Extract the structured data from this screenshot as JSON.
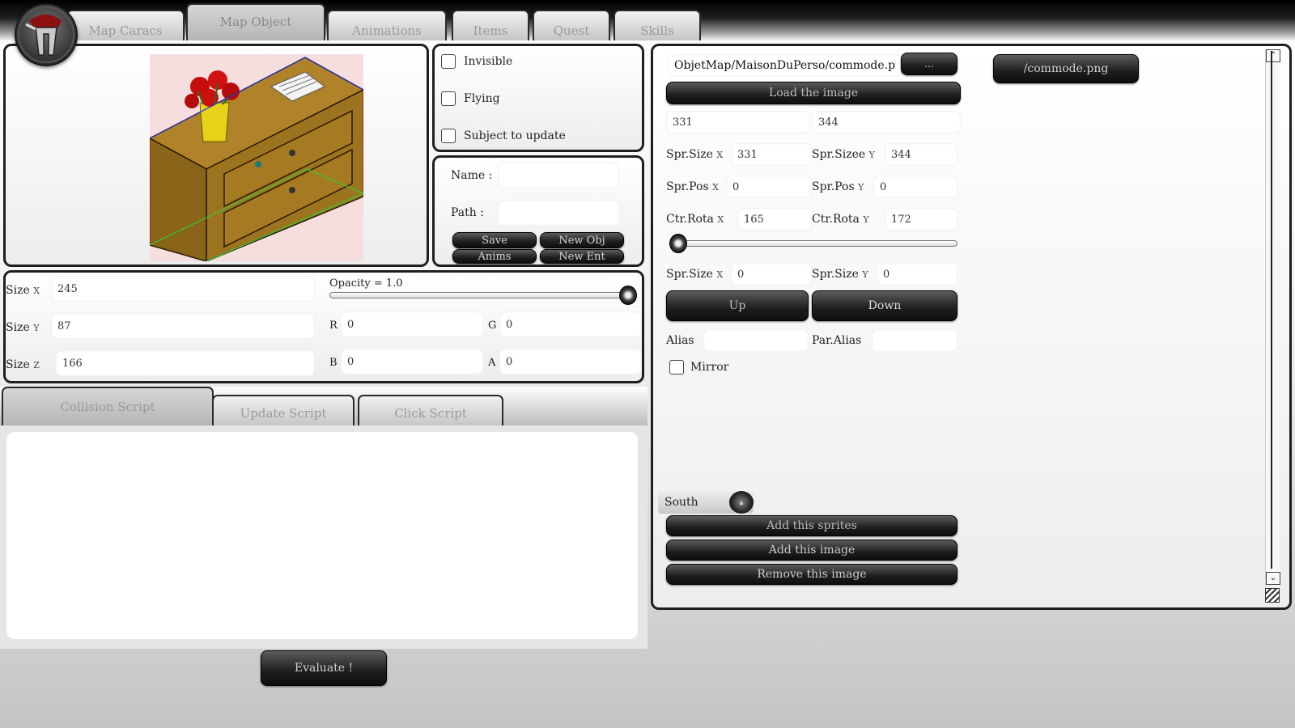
{
  "nav_tabs": [
    {
      "label": "Map Caracs"
    },
    {
      "label": "Map Object"
    },
    {
      "label": "Animations"
    },
    {
      "label": "Items"
    },
    {
      "label": "Quest"
    },
    {
      "label": "Skills"
    }
  ],
  "flags": {
    "invisible": "Invisible",
    "flying": "Flying",
    "subject_to_update": "Subject to update"
  },
  "object_form": {
    "name_label": "Name :",
    "name_value": "",
    "path_label": "Path :",
    "path_value": "",
    "save": "Save",
    "new_obj": "New Obj",
    "anims": "Anims",
    "new_ent": "New Ent"
  },
  "size": {
    "x_label": "Size",
    "x_axis": "X",
    "x_value": "245",
    "y_label": "Size",
    "y_axis": "Y",
    "y_value": "87",
    "z_label": "Size",
    "z_axis": "Z",
    "z_value": "166"
  },
  "opacity": {
    "label": "Opacity = 1.0",
    "value": 1.0
  },
  "color": {
    "r_label": "R",
    "r_value": "0",
    "g_label": "G",
    "g_value": "0",
    "b_label": "B",
    "b_value": "0",
    "a_label": "A",
    "a_value": "0"
  },
  "script_tabs": [
    {
      "label": "Collision Script"
    },
    {
      "label": "Update Script"
    },
    {
      "label": "Click Script"
    }
  ],
  "script_text": "",
  "evaluate": "Evaluate !",
  "sprite": {
    "path_value": "ObjetMap/MaisonDuPerso/commode.png",
    "browse": "...",
    "load_image": "Load the image",
    "img_w": "331",
    "img_h": "344",
    "spr_size_x_label": "Spr.Size",
    "spr_size_x_axis": "X",
    "spr_size_x_value": "331",
    "spr_size_y_label": "Spr.Sizee",
    "spr_size_y_axis": "Y",
    "spr_size_y_value": "344",
    "spr_pos_x_label": "Spr.Pos",
    "spr_pos_x_axis": "X",
    "spr_pos_x_value": "0",
    "spr_pos_y_label": "Spr.Pos",
    "spr_pos_y_axis": "Y",
    "spr_pos_y_value": "0",
    "ctr_rota_x_label": "Ctr.Rota",
    "ctr_rota_x_axis": "X",
    "ctr_rota_x_value": "165",
    "ctr_rota_y_label": "Ctr.Rota",
    "ctr_rota_y_axis": "Y",
    "ctr_rota_y_value": "172",
    "rotation_value": 0,
    "spr_size2_x_label": "Spr.Size",
    "spr_size2_x_axis": "X",
    "spr_size2_x_value": "0",
    "spr_size2_y_label": "Spr.Size",
    "spr_size2_y_axis": "Y",
    "spr_size2_y_value": "0",
    "up": "Up",
    "down": "Down",
    "alias_label": "Alias",
    "alias_value": "",
    "par_alias_label": "Par.Alias",
    "par_alias_value": "",
    "mirror": "Mirror",
    "direction": "South",
    "add_sprites": "Add this sprites",
    "add_image": "Add this image",
    "remove_image": "Remove this image"
  },
  "image_list": [
    {
      "label": "/commode.png"
    }
  ],
  "icons": {
    "logo": "game-logo-icon",
    "dropdown": "dropdown-icon",
    "scroll_up": "arrow-up-icon",
    "scroll_down": "arrow-down-icon",
    "resize": "resize-grip-icon"
  },
  "colors": {
    "dark_button": "#1d1d1d",
    "panel_border": "#1f1f1f",
    "tab_text": "#9a9a9a"
  }
}
